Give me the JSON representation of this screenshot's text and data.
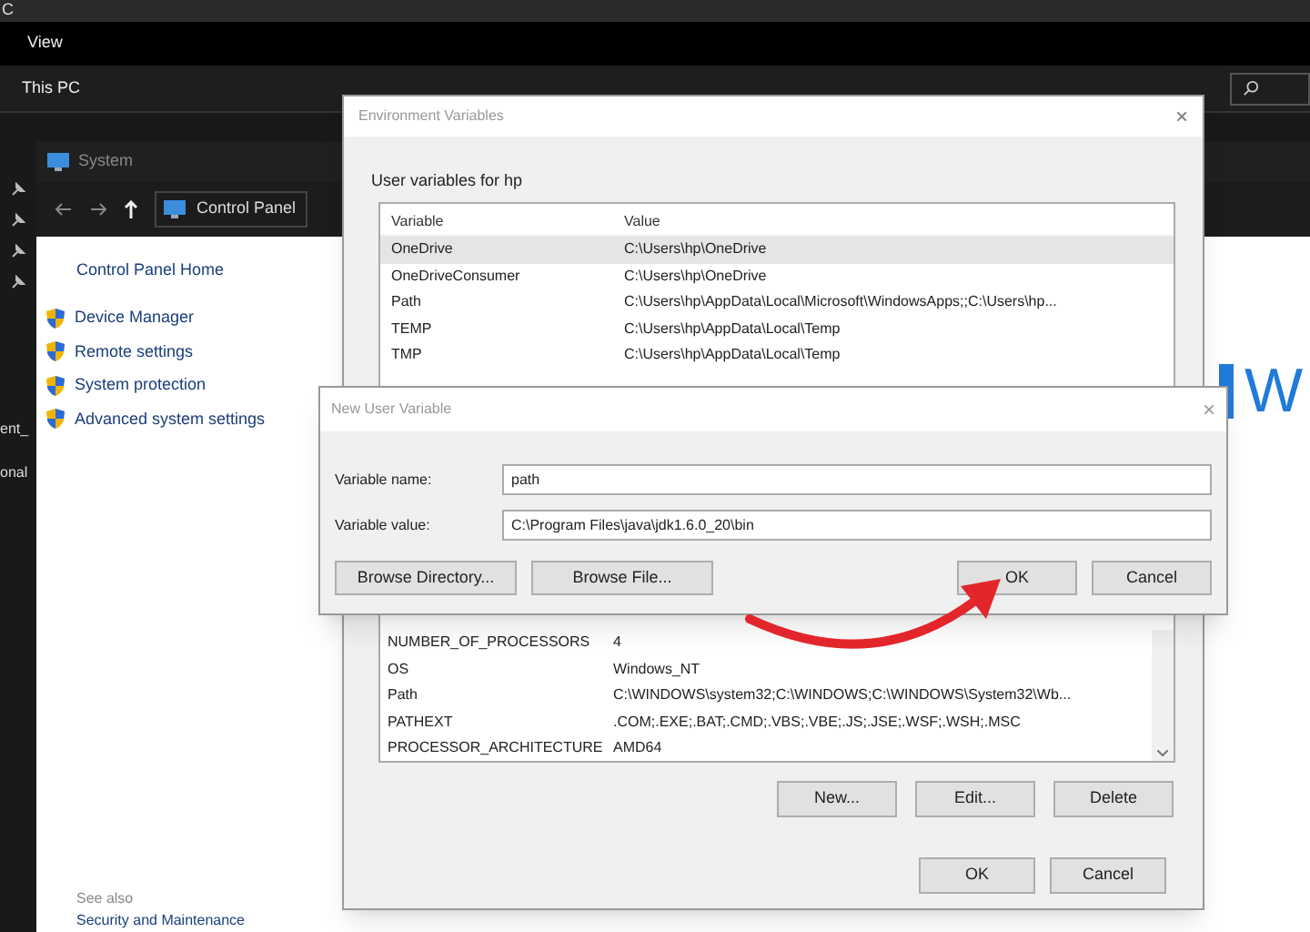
{
  "explorer": {
    "title": "C",
    "menu": [
      "View"
    ],
    "address": "This PC",
    "nav_fragments": [
      "ent_",
      "onal"
    ]
  },
  "system_window": {
    "title": "System",
    "address": "Control Panel",
    "home_link": "Control Panel Home",
    "links": [
      "Device Manager",
      "Remote settings",
      "System protection",
      "Advanced system settings"
    ],
    "see_also": "See also",
    "see_also_link": "Security and Maintenance",
    "banner_text": "W"
  },
  "env_dialog": {
    "title": "Environment Variables",
    "close": "×",
    "user_group": "User variables for hp",
    "columns": [
      "Variable",
      "Value"
    ],
    "user_rows": [
      {
        "variable": "OneDrive",
        "value": "C:\\Users\\hp\\OneDrive",
        "selected": true
      },
      {
        "variable": "OneDriveConsumer",
        "value": "C:\\Users\\hp\\OneDrive",
        "selected": false
      },
      {
        "variable": "Path",
        "value": "C:\\Users\\hp\\AppData\\Local\\Microsoft\\WindowsApps;;C:\\Users\\hp...",
        "selected": false
      },
      {
        "variable": "TEMP",
        "value": "C:\\Users\\hp\\AppData\\Local\\Temp",
        "selected": false
      },
      {
        "variable": "TMP",
        "value": "C:\\Users\\hp\\AppData\\Local\\Temp",
        "selected": false
      }
    ],
    "system_rows": [
      {
        "variable": "NUMBER_OF_PROCESSORS",
        "value": "4"
      },
      {
        "variable": "OS",
        "value": "Windows_NT"
      },
      {
        "variable": "Path",
        "value": "C:\\WINDOWS\\system32;C:\\WINDOWS;C:\\WINDOWS\\System32\\Wb..."
      },
      {
        "variable": "PATHEXT",
        "value": ".COM;.EXE;.BAT;.CMD;.VBS;.VBE;.JS;.JSE;.WSF;.WSH;.MSC"
      },
      {
        "variable": "PROCESSOR_ARCHITECTURE",
        "value": "AMD64"
      }
    ],
    "system_buttons": [
      "New...",
      "Edit...",
      "Delete"
    ],
    "buttons": [
      "OK",
      "Cancel"
    ]
  },
  "new_var_dialog": {
    "title": "New User Variable",
    "close": "×",
    "fields": [
      {
        "label": "Variable name:",
        "value": "path"
      },
      {
        "label": "Variable value:",
        "value": "C:\\Program Files\\java\\jdk1.6.0_20\\bin"
      }
    ],
    "browse_buttons": [
      "Browse Directory...",
      "Browse File..."
    ],
    "buttons": [
      "OK",
      "Cancel"
    ]
  }
}
